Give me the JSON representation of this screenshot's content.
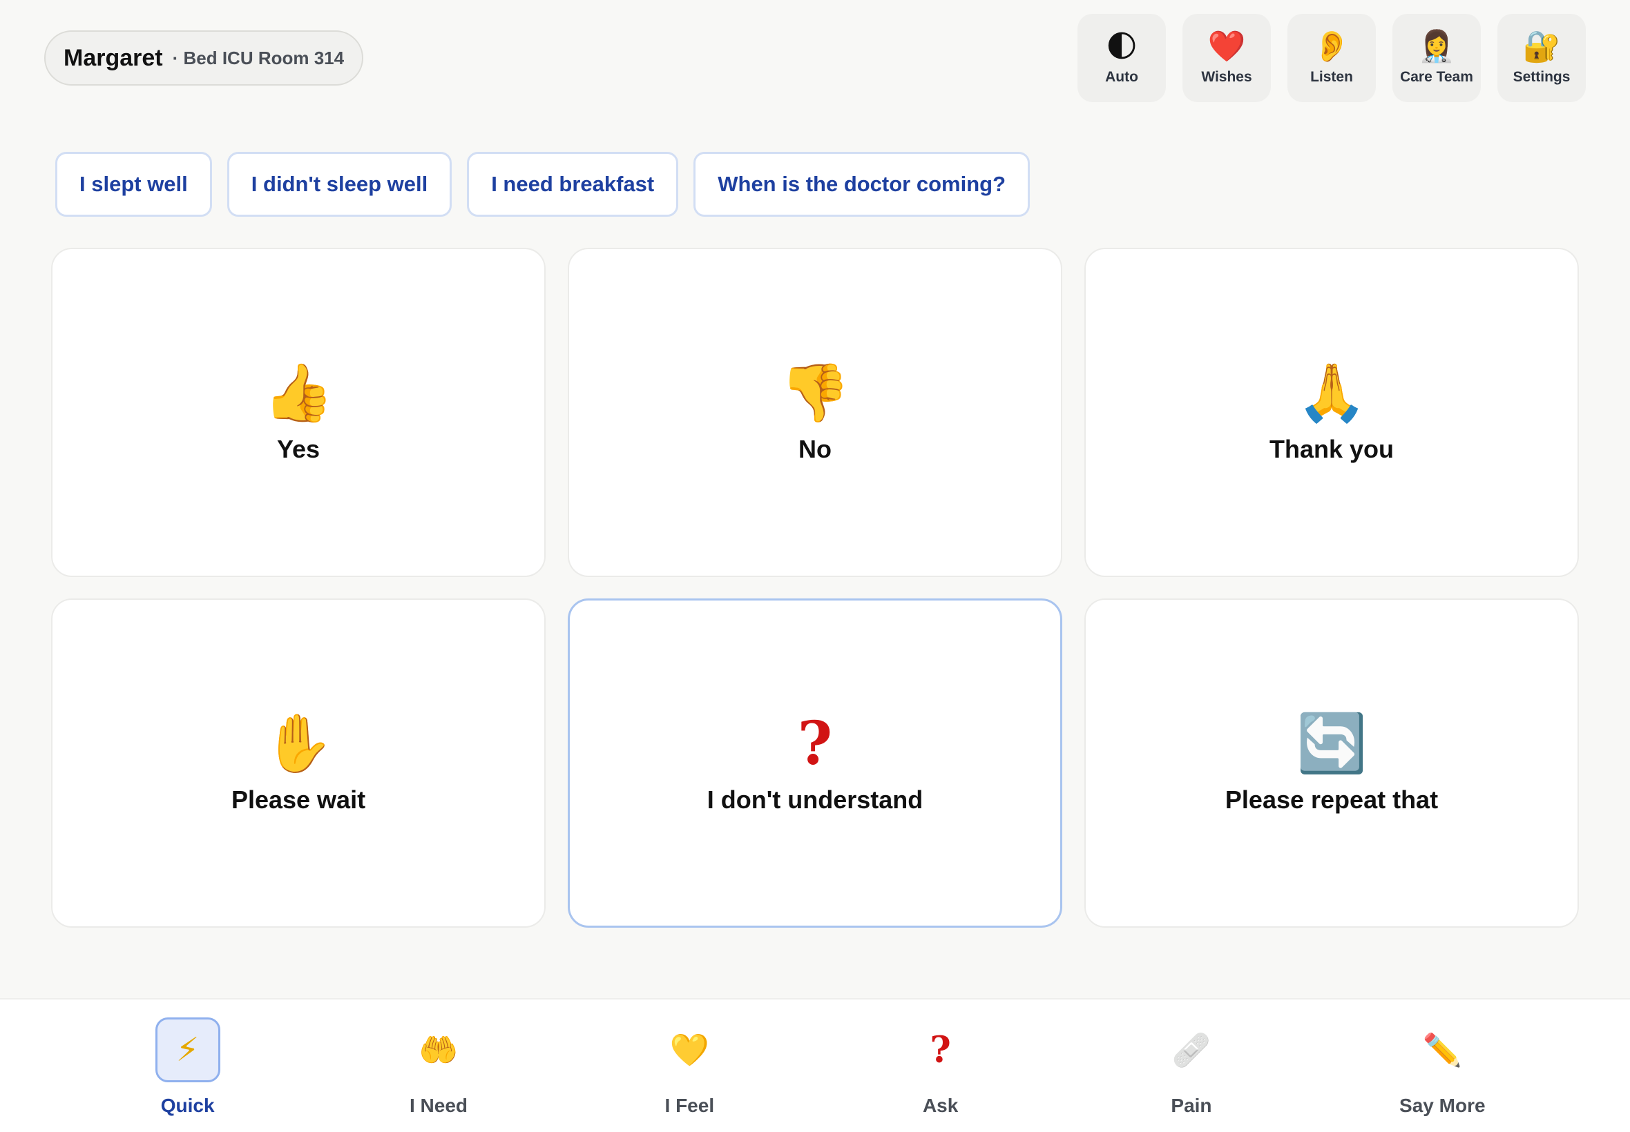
{
  "patient": {
    "name": "Margaret",
    "bed": "· Bed ICU Room 314"
  },
  "top_actions": [
    {
      "label": "Auto",
      "icon": "🌓",
      "icon_name": "moon-icon"
    },
    {
      "label": "Wishes",
      "icon": "❤️",
      "icon_name": "heart-icon"
    },
    {
      "label": "Listen",
      "icon": "👂",
      "icon_name": "ear-icon"
    },
    {
      "label": "Care Team",
      "icon": "👩‍⚕️",
      "icon_name": "health-worker-icon"
    },
    {
      "label": "Settings",
      "icon": "🔐",
      "icon_name": "lock-icon"
    }
  ],
  "suggestions": [
    "I slept well",
    "I didn't sleep well",
    "I need breakfast",
    "When is the doctor coming?"
  ],
  "cards": [
    {
      "label": "Yes",
      "icon": "👍",
      "icon_name": "thumbs-up-icon"
    },
    {
      "label": "No",
      "icon": "👎",
      "icon_name": "thumbs-down-icon"
    },
    {
      "label": "Thank you",
      "icon": "🙏",
      "icon_name": "folded-hands-icon"
    },
    {
      "label": "Please wait",
      "icon": "✋",
      "icon_name": "raised-hand-icon"
    },
    {
      "label": "I don't understand",
      "icon": "?",
      "icon_name": "question-mark-icon",
      "selected": true
    },
    {
      "label": "Please repeat that",
      "icon": "🔄",
      "icon_name": "repeat-icon"
    }
  ],
  "bottom_nav": [
    {
      "label": "Quick",
      "icon": "⚡",
      "icon_name": "lightning-icon",
      "active": true
    },
    {
      "label": "I Need",
      "icon": "🤲",
      "icon_name": "open-hands-icon"
    },
    {
      "label": "I Feel",
      "icon": "💛",
      "icon_name": "yellow-heart-icon"
    },
    {
      "label": "Ask",
      "icon": "?",
      "icon_name": "question-mark-icon"
    },
    {
      "label": "Pain",
      "icon": "🩹",
      "icon_name": "bandage-icon"
    },
    {
      "label": "Say More",
      "icon": "✏️",
      "icon_name": "pencil-icon"
    }
  ],
  "colors": {
    "accent": "#1e40a0",
    "selected_border": "#a9c4ef",
    "background": "#f8f8f6"
  }
}
